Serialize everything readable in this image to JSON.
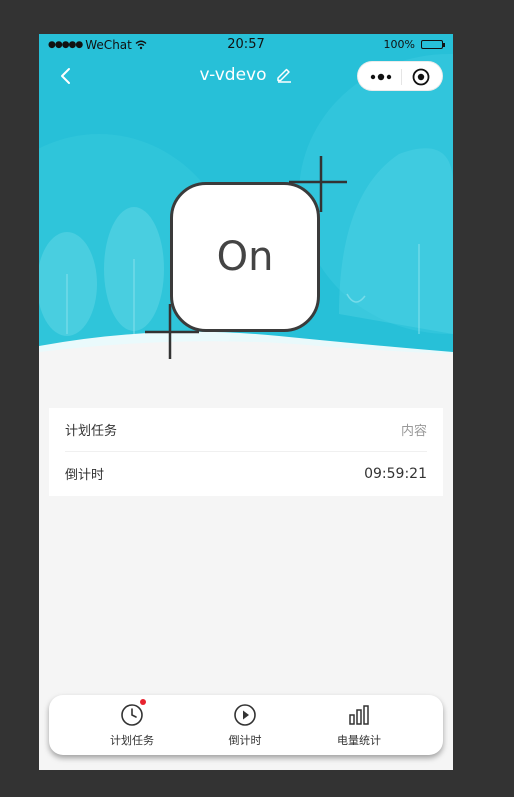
{
  "status_bar": {
    "signal_dots": "●●●●●",
    "carrier": "WeChat",
    "time": "20:57",
    "battery_percent": "100%"
  },
  "navbar": {
    "title": "v-vdevo",
    "back_icon": "chevron-left-icon",
    "edit_icon": "pencil-icon",
    "more_icon": "more-dots-icon",
    "close_icon": "target-circle-icon"
  },
  "device": {
    "state_label": "On"
  },
  "rows": [
    {
      "label": "计划任务",
      "value": "内容"
    },
    {
      "label": "倒计时",
      "value": "09:59:21"
    }
  ],
  "tabbar": {
    "items": [
      {
        "label": "计划任务",
        "icon": "clock-icon",
        "badge": true
      },
      {
        "label": "倒计时",
        "icon": "play-circle-icon",
        "badge": false
      },
      {
        "label": "电量统计",
        "icon": "bar-chart-icon",
        "badge": false
      }
    ]
  },
  "colors": {
    "header_bg": "#27c0d8",
    "page_bg": "#f5f5f5",
    "badge": "#e8232f",
    "outer_bg": "#333333"
  }
}
